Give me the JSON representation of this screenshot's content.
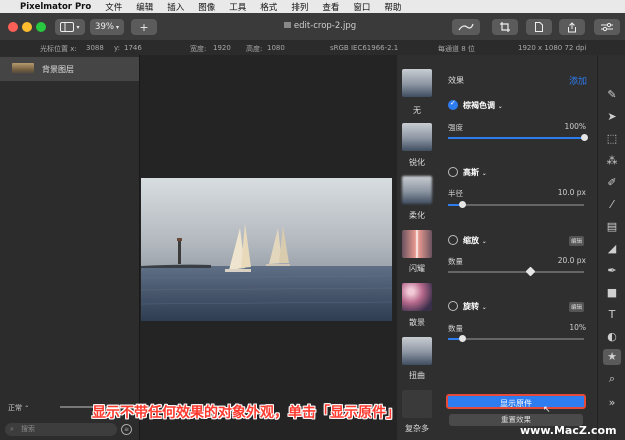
{
  "menubar": {
    "app": "Pixelmator Pro",
    "items": [
      "文件",
      "编辑",
      "插入",
      "图像",
      "工具",
      "格式",
      "排列",
      "查看",
      "窗口",
      "帮助"
    ]
  },
  "toolbar": {
    "zoom": "39%",
    "add": "+",
    "doc_title": "edit-crop-2.jpg"
  },
  "infobar": {
    "cursor_x_label": "光标位置 x:",
    "cursor_x": "3088",
    "cursor_y_label": "y:",
    "cursor_y": "1746",
    "width_label": "宽度:",
    "width": "1920",
    "height_label": "高度:",
    "height": "1080",
    "profile": "sRGB IEC61966-2.1",
    "bits": "每通道 8 位",
    "size": "1920 x 1080 72 dpi"
  },
  "layers": {
    "items": [
      {
        "name": "背景图层"
      }
    ],
    "blend_mode": "正常",
    "search_placeholder": "搜索"
  },
  "thumbnails": [
    {
      "label": "无"
    },
    {
      "label": "锐化"
    },
    {
      "label": "柔化"
    },
    {
      "label": "闪耀"
    },
    {
      "label": "散景"
    },
    {
      "label": "扭曲"
    },
    {
      "label": "复杂多"
    }
  ],
  "effects": {
    "header": "效果",
    "add_label": "添加",
    "items": [
      {
        "name": "棕褐色调",
        "enabled": true,
        "param": "强度",
        "value": "100%",
        "level": 1.0
      },
      {
        "name": "高斯",
        "enabled": false,
        "param": "半径",
        "value": "10.0 px",
        "level": 0.1
      },
      {
        "name": "缩放",
        "enabled": false,
        "badge": "编辑",
        "param": "数量",
        "value": "20.0 px",
        "level": 0.6
      },
      {
        "name": "旋转",
        "enabled": false,
        "badge": "编辑",
        "param": "数量",
        "value": "10%",
        "level": 0.1
      }
    ],
    "show_original": "显示原件",
    "reset": "重置效果"
  },
  "caption": "显示不带任何效果的对象外观，单击「显示原件」",
  "watermark": "www.MacZ.com",
  "colors": {
    "accent": "#2d7cf0",
    "caption": "#ff3b30"
  }
}
